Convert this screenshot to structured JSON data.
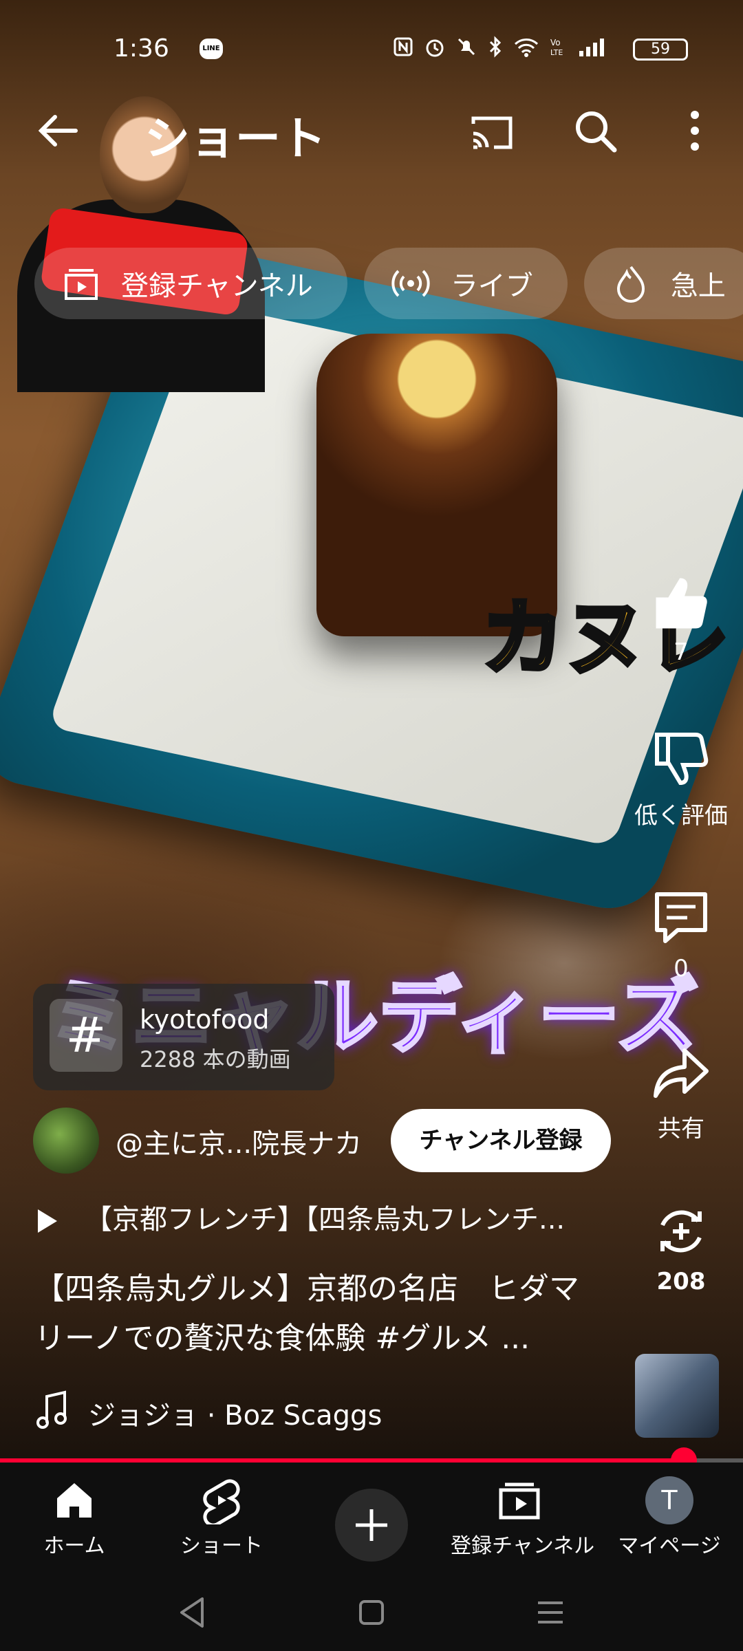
{
  "status_bar": {
    "time": "1:36",
    "line_badge": "LINE",
    "battery": "59"
  },
  "app_bar": {
    "title": "ショート"
  },
  "chips": [
    {
      "label": "登録チャンネル",
      "icon": "subscriptions-icon"
    },
    {
      "label": "ライブ",
      "icon": "live-icon"
    },
    {
      "label": "急上",
      "icon": "trending-icon"
    }
  ],
  "video_overlay": {
    "top_text": "カヌレ",
    "bottom_text": "ミニャルディーズ"
  },
  "actions": {
    "like_count": "7",
    "dislike_label": "低く評価",
    "comment_count": "0",
    "share_label": "共有",
    "remix_count": "208"
  },
  "hashtag": {
    "symbol": "#",
    "name": "kyotofood",
    "count": "2288 本の動画"
  },
  "channel": {
    "name": "@主に京...院長ナカ",
    "subscribe_label": "チャンネル登録"
  },
  "related_video": "【京都フレンチ】【四条烏丸フレンチ...",
  "description": "【四条烏丸グルメ】京都の名店　ヒダマリーノでの贅沢な食体験 #グルメ ...",
  "music": "ジョジョ · Boz Scaggs",
  "progress": {
    "fraction": 0.92
  },
  "bottom_nav": [
    {
      "label": "ホーム",
      "icon": "home-icon"
    },
    {
      "label": "ショート",
      "icon": "shorts-icon"
    },
    {
      "label": "",
      "icon": "plus-icon"
    },
    {
      "label": "登録チャンネル",
      "icon": "subscriptions-icon"
    },
    {
      "label": "マイページ",
      "icon": "avatar-icon",
      "avatar_letter": "T"
    }
  ]
}
